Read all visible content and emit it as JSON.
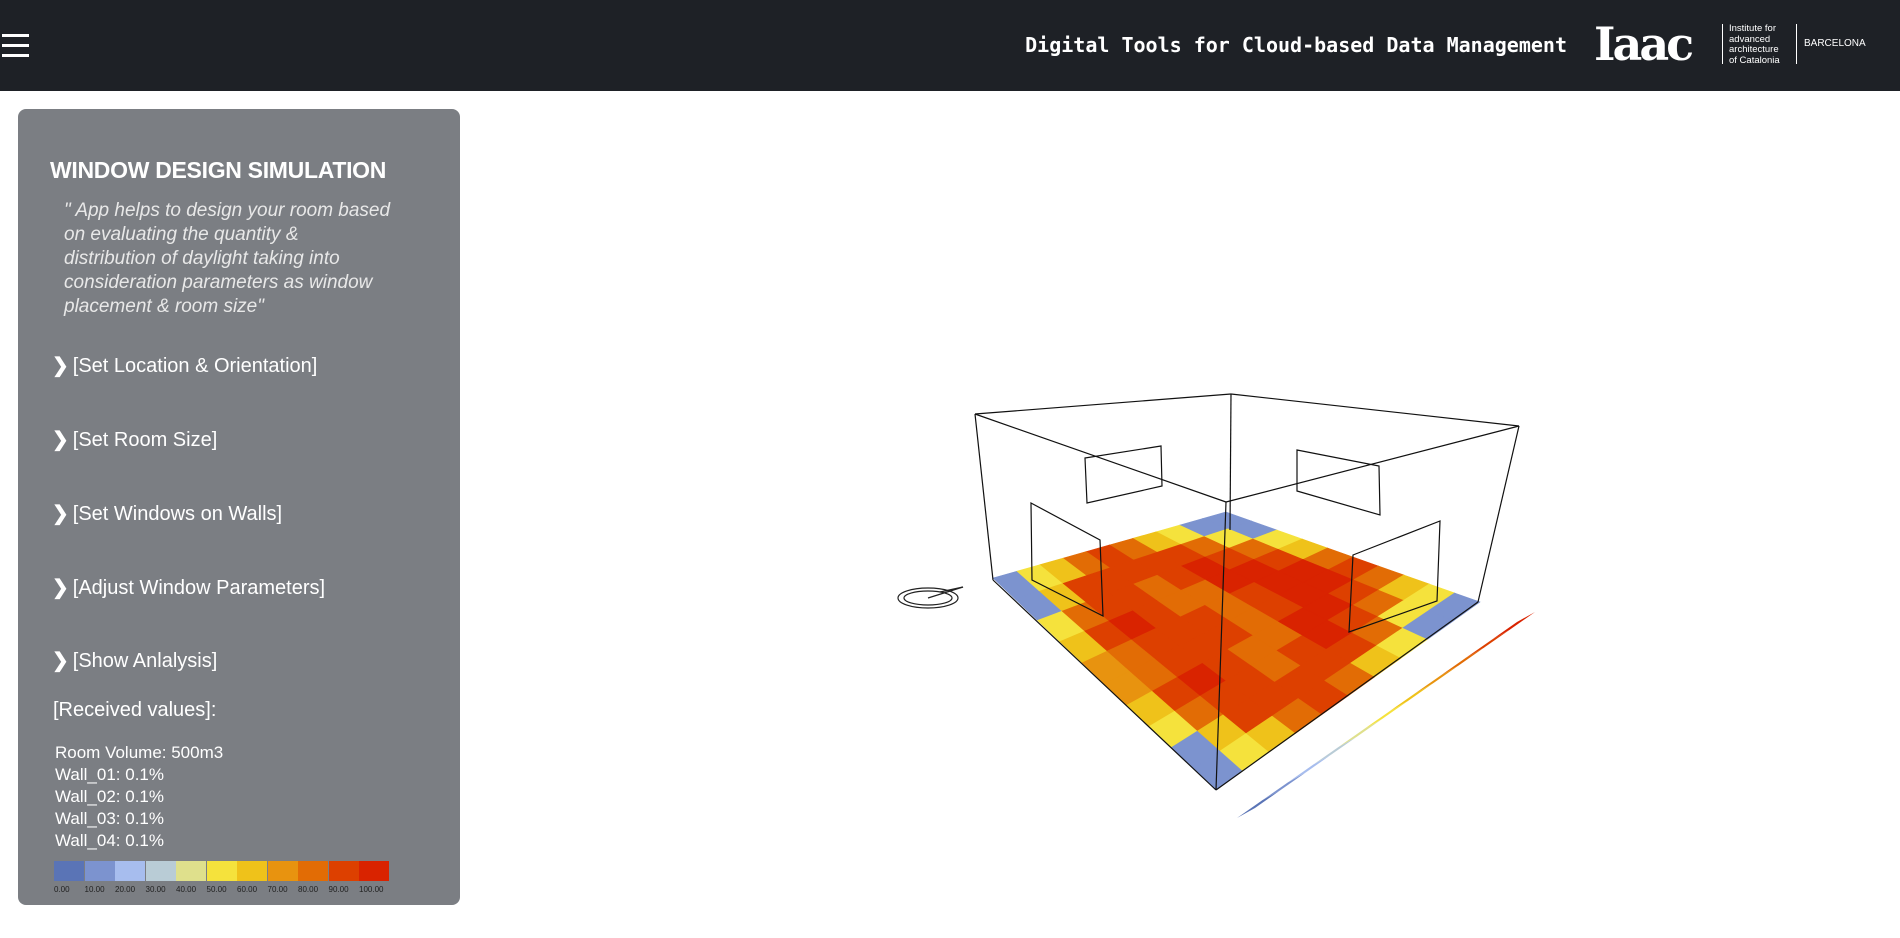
{
  "header": {
    "title": "Digital Tools for Cloud-based Data Management",
    "logo_mark": "Iaac",
    "logo_text": [
      "Institute for",
      "advanced",
      "architecture",
      "of Catalonia"
    ],
    "logo_city": "BARCELONA"
  },
  "panel": {
    "title": "WINDOW DESIGN SIMULATION",
    "description": "\" App helps to design your room based on evaluating the quantity & distribution of daylight taking into consideration parameters as window placement & room size\"",
    "accordion": [
      "[Set Location & Orientation]",
      "[Set Room Size]",
      "[Set Windows on Walls]",
      "[Adjust Window Parameters]",
      "[Show Anlalysis]"
    ],
    "received_title": "[Received values]:",
    "values": [
      "Room Volume: 500m3",
      "Wall_01: 0.1%",
      "Wall_02: 0.1%",
      "Wall_03: 0.1%",
      "Wall_04: 0.1%"
    ]
  },
  "legend": {
    "labels": [
      "0.00",
      "10.00",
      "20.00",
      "30.00",
      "40.00",
      "50.00",
      "60.00",
      "70.00",
      "80.00",
      "90.00",
      "100.00"
    ],
    "colors": [
      "#5a74b6",
      "#7c93cf",
      "#a7bdee",
      "#b9ccd6",
      "#dfe08c",
      "#f5e23c",
      "#efc21a",
      "#e8930f",
      "#e26c05",
      "#dd4000",
      "#d92300"
    ]
  },
  "heatmap": {
    "rows": 10,
    "cols": 10,
    "values": [
      [
        5,
        10,
        45,
        60,
        80,
        85,
        80,
        60,
        45,
        5
      ],
      [
        10,
        50,
        80,
        90,
        95,
        95,
        90,
        80,
        50,
        10
      ],
      [
        45,
        80,
        90,
        95,
        100,
        100,
        95,
        90,
        80,
        45
      ],
      [
        60,
        90,
        95,
        95,
        90,
        90,
        95,
        95,
        90,
        60
      ],
      [
        80,
        90,
        85,
        80,
        80,
        80,
        80,
        85,
        90,
        80
      ],
      [
        85,
        90,
        80,
        80,
        85,
        85,
        80,
        80,
        90,
        85
      ],
      [
        80,
        90,
        85,
        85,
        90,
        90,
        85,
        85,
        90,
        80
      ],
      [
        60,
        85,
        90,
        95,
        90,
        90,
        95,
        90,
        85,
        60
      ],
      [
        45,
        55,
        80,
        85,
        80,
        80,
        85,
        80,
        55,
        45
      ],
      [
        5,
        10,
        45,
        60,
        70,
        70,
        60,
        45,
        10,
        5
      ]
    ]
  }
}
